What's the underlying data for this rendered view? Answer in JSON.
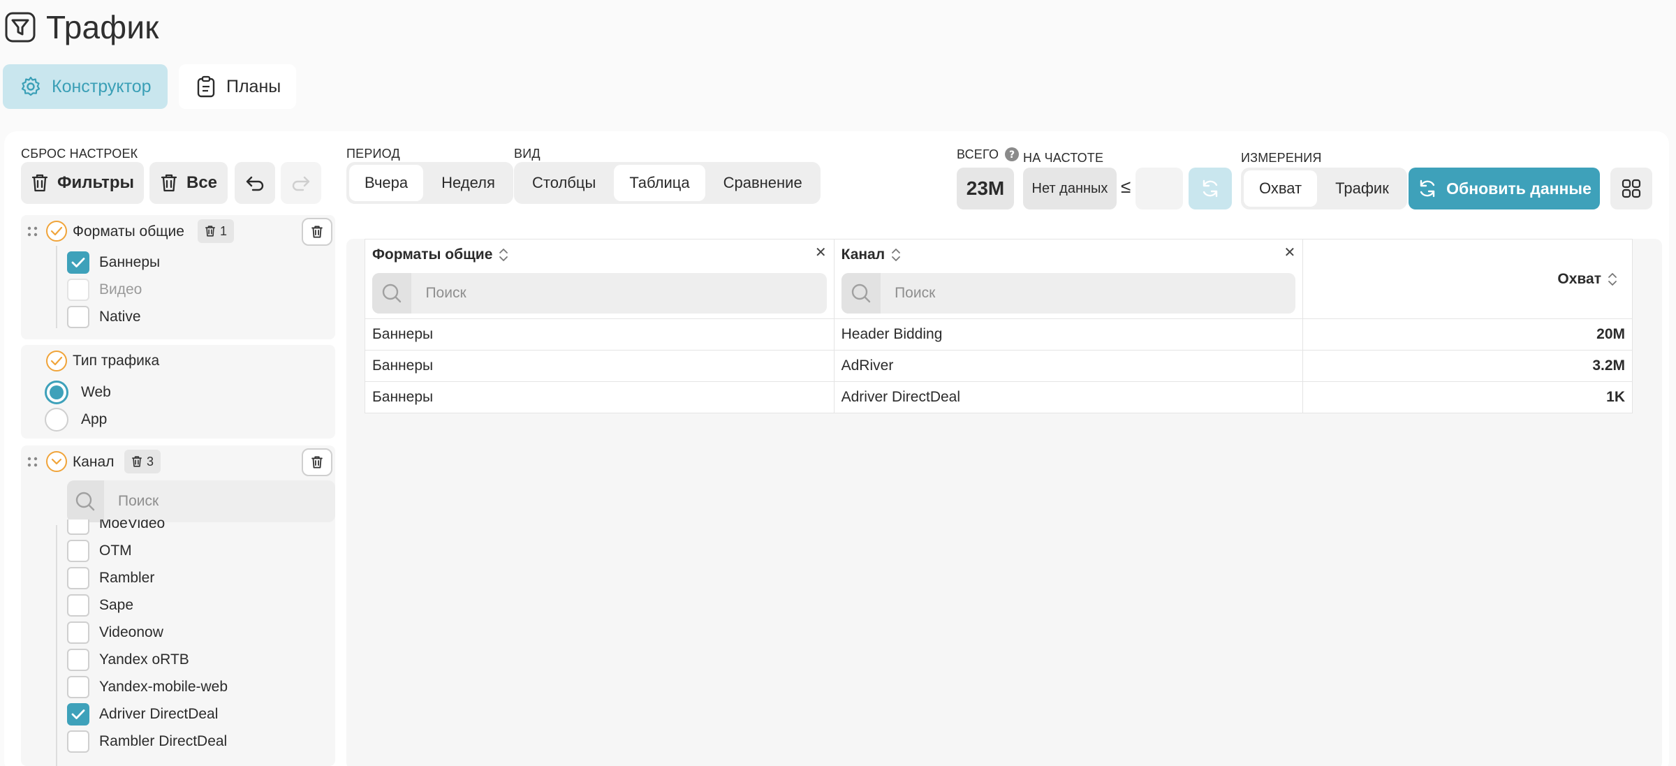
{
  "header": {
    "title": "Трафик"
  },
  "tabs": [
    {
      "label": "Конструктор",
      "active": true
    },
    {
      "label": "Планы",
      "active": false
    }
  ],
  "toolbar": {
    "reset_label": "СБРОС НАСТРОЕК",
    "filters_btn": "Фильтры",
    "all_btn": "Все",
    "period_label": "ПЕРИОД",
    "period_options": [
      "Вчера",
      "Неделя"
    ],
    "period_selected": "Вчера",
    "view_label": "ВИД",
    "view_options": [
      "Столбцы",
      "Таблица",
      "Сравнение"
    ],
    "view_selected": "Таблица",
    "total_label": "ВСЕГО",
    "total_value": "23M",
    "freq_label": "НА ЧАСТОТЕ",
    "freq_value": "Нет данных",
    "freq_le": "≤",
    "measure_label": "ИЗМЕРЕНИЯ",
    "measure_options": [
      "Охват",
      "Трафик"
    ],
    "measure_selected": "Охват",
    "refresh_label": "Обновить данные"
  },
  "filters": {
    "formats": {
      "title": "Форматы общие",
      "count": "1",
      "options": [
        {
          "label": "Баннеры",
          "checked": true
        },
        {
          "label": "Видео",
          "checked": false,
          "faded": true
        },
        {
          "label": "Native",
          "checked": false
        }
      ]
    },
    "traffic_type": {
      "title": "Тип трафика",
      "options": [
        {
          "label": "Web",
          "selected": true
        },
        {
          "label": "App",
          "selected": false
        }
      ]
    },
    "channel": {
      "title": "Канал",
      "count": "3",
      "search_placeholder": "Поиск",
      "options": [
        {
          "label": "MoeVideo",
          "checked": false
        },
        {
          "label": "OTM",
          "checked": false
        },
        {
          "label": "Rambler",
          "checked": false
        },
        {
          "label": "Sape",
          "checked": false
        },
        {
          "label": "Videonow",
          "checked": false
        },
        {
          "label": "Yandex oRTB",
          "checked": false
        },
        {
          "label": "Yandex-mobile-web",
          "checked": false
        },
        {
          "label": "Adriver DirectDeal",
          "checked": true
        },
        {
          "label": "Rambler DirectDeal",
          "checked": false
        }
      ]
    }
  },
  "table": {
    "columns": [
      {
        "title": "Форматы общие",
        "search_placeholder": "Поиск"
      },
      {
        "title": "Канал",
        "search_placeholder": "Поиск"
      },
      {
        "title": "Охват"
      }
    ],
    "rows": [
      [
        "Баннеры",
        "Header Bidding",
        "20M"
      ],
      [
        "Баннеры",
        "AdRiver",
        "3.2M"
      ],
      [
        "Баннеры",
        "Adriver DirectDeal",
        "1K"
      ]
    ]
  },
  "colors": {
    "accent": "#3ea1ba",
    "accent_light": "#c9e6ee",
    "check_circle": "#f0a43a"
  }
}
